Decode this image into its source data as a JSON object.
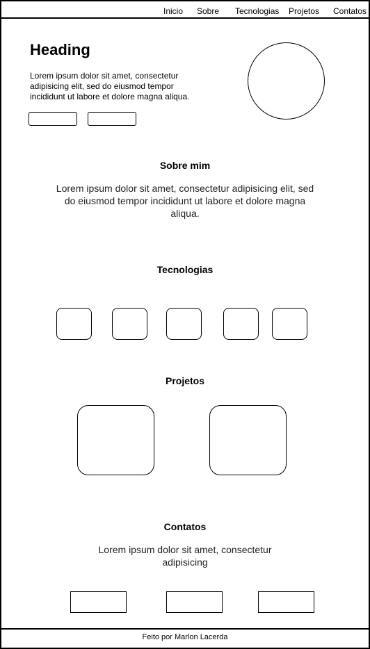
{
  "nav": {
    "items": [
      "Inicio",
      "Sobre",
      "Tecnologias",
      "Projetos",
      "Contatos"
    ]
  },
  "hero": {
    "heading": "Heading",
    "text": "Lorem ipsum dolor sit amet, consectetur adipisicing elit, sed do eiusmod tempor incididunt ut labore et dolore magna aliqua."
  },
  "sobre": {
    "title": "Sobre mim",
    "text": "Lorem ipsum dolor sit amet, consectetur adipisicing elit, sed do eiusmod tempor incididunt ut labore et dolore magna aliqua."
  },
  "tecnologias": {
    "title": "Tecnologias"
  },
  "projetos": {
    "title": "Projetos"
  },
  "contatos": {
    "title": "Contatos",
    "text": "Lorem ipsum dolor sit amet, consectetur adipisicing"
  },
  "footer": {
    "text": "Feito por Marlon Lacerda"
  }
}
